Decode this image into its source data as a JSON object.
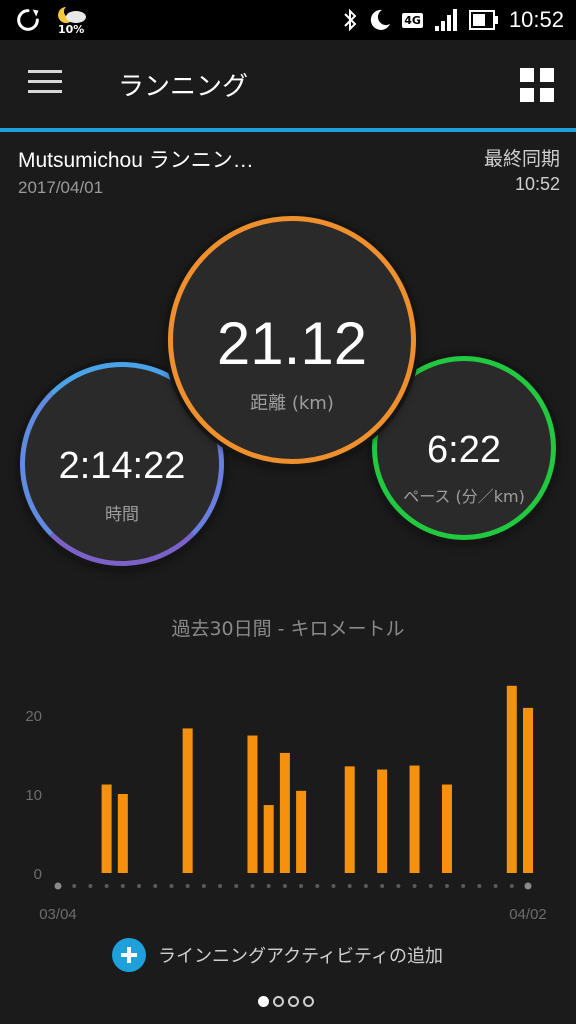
{
  "status_bar": {
    "time": "10:52",
    "weather_percent": "10%",
    "network": "4G",
    "icons": [
      "sync-icon",
      "weather-icon",
      "bluetooth-icon",
      "do-not-disturb-moon-icon",
      "signal-icon",
      "battery-icon"
    ]
  },
  "app_bar": {
    "title": "ランニング",
    "menu_icon": "hamburger-menu-icon",
    "widgets_icon": "grid-icon"
  },
  "activity": {
    "name": "Mutsumichou ランニン…",
    "date": "2017/04/01",
    "sync_label": "最終同期",
    "sync_time": "10:52"
  },
  "metrics": {
    "distance": {
      "value": "21.12",
      "label": "距離 (km)"
    },
    "time": {
      "value": "2:14:22",
      "label": "時間"
    },
    "pace": {
      "value": "6:22",
      "label": "ペース (分／km)"
    }
  },
  "colors": {
    "accent": "#1ea0db",
    "distance_ring": "#f0902d",
    "pace_ring": "#22c940",
    "time_ring": "#4aa3e8",
    "bar": "#f5910f"
  },
  "chart_data": {
    "type": "bar",
    "title": "過去30日間 - キロメートル",
    "xlabel": "",
    "ylabel": "",
    "ylim": [
      0,
      25
    ],
    "yticks": [
      0,
      10,
      20
    ],
    "x_labels": [
      "03/04",
      "04/02"
    ],
    "day_count": 30,
    "bars": [
      {
        "day": 4,
        "value": 11.2
      },
      {
        "day": 5,
        "value": 10.0
      },
      {
        "day": 9,
        "value": 18.3
      },
      {
        "day": 13,
        "value": 17.4
      },
      {
        "day": 14,
        "value": 8.6
      },
      {
        "day": 15,
        "value": 15.2
      },
      {
        "day": 16,
        "value": 10.4
      },
      {
        "day": 19,
        "value": 13.5
      },
      {
        "day": 21,
        "value": 13.1
      },
      {
        "day": 23,
        "value": 13.6
      },
      {
        "day": 25,
        "value": 11.2
      },
      {
        "day": 29,
        "value": 23.7
      },
      {
        "day": 30,
        "value": 20.9
      }
    ]
  },
  "add_activity": {
    "label": "ラインニングアクティビティの追加"
  },
  "pager": {
    "count": 4,
    "active": 0
  }
}
